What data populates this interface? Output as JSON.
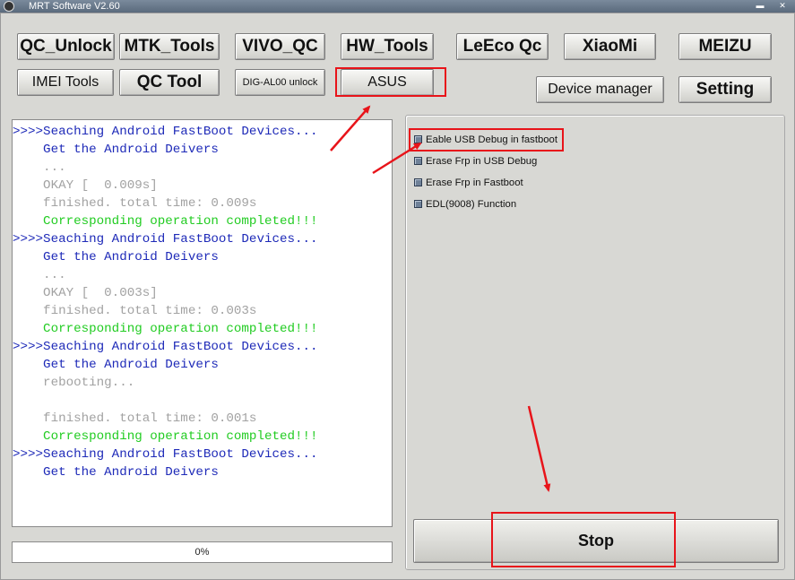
{
  "window": {
    "title": "MRT Software V2.60",
    "controls": {
      "minimize": "▬",
      "close": "✕"
    }
  },
  "toolbar": {
    "qc_unlock": "QC_Unlock",
    "mtk_tools": "MTK_Tools",
    "vivo_qc": "VIVO_QC",
    "hw_tools": "HW_Tools",
    "leeco_qc": "LeEco Qc",
    "xiaomi": "XiaoMi",
    "meizu": "MEIZU",
    "imei_tools": "IMEI Tools",
    "qc_tool": "QC Tool",
    "dig_al00_unlock": "DIG-AL00 unlock",
    "asus": "ASUS",
    "device_manager": "Device manager",
    "setting": "Setting"
  },
  "log": {
    "lines": [
      {
        "text": ">>>>Seaching Android FastBoot Devices...",
        "color": "#1e2ab8"
      },
      {
        "text": "    Get the Android Deivers",
        "color": "#1e2ab8"
      },
      {
        "text": "    ...",
        "color": "#a2a2a2"
      },
      {
        "text": "    OKAY [  0.009s]",
        "color": "#a2a2a2"
      },
      {
        "text": "    finished. total time: 0.009s",
        "color": "#a2a2a2"
      },
      {
        "text": "    Corresponding operation completed!!!",
        "color": "#22cc22"
      },
      {
        "text": ">>>>Seaching Android FastBoot Devices...",
        "color": "#1e2ab8"
      },
      {
        "text": "    Get the Android Deivers",
        "color": "#1e2ab8"
      },
      {
        "text": "    ...",
        "color": "#a2a2a2"
      },
      {
        "text": "    OKAY [  0.003s]",
        "color": "#a2a2a2"
      },
      {
        "text": "    finished. total time: 0.003s",
        "color": "#a2a2a2"
      },
      {
        "text": "    Corresponding operation completed!!!",
        "color": "#22cc22"
      },
      {
        "text": ">>>>Seaching Android FastBoot Devices...",
        "color": "#1e2ab8"
      },
      {
        "text": "    Get the Android Deivers",
        "color": "#1e2ab8"
      },
      {
        "text": "    rebooting...",
        "color": "#a2a2a2"
      },
      {
        "text": "",
        "color": "#a2a2a2"
      },
      {
        "text": "    finished. total time: 0.001s",
        "color": "#a2a2a2"
      },
      {
        "text": "    Corresponding operation completed!!!",
        "color": "#22cc22"
      },
      {
        "text": ">>>>Seaching Android FastBoot Devices...",
        "color": "#1e2ab8"
      },
      {
        "text": "    Get the Android Deivers",
        "color": "#1e2ab8"
      }
    ]
  },
  "progress": {
    "value": 0,
    "text": "0%"
  },
  "options": {
    "items": [
      {
        "label": "Eable USB Debug in fastboot"
      },
      {
        "label": "Erase Frp in USB Debug"
      },
      {
        "label": "Erase Frp in Fastboot"
      },
      {
        "label": "EDL(9008) Function"
      }
    ]
  },
  "actions": {
    "stop": "Stop"
  },
  "colors": {
    "highlight": "#e8141a",
    "log_blue": "#1e2ab8",
    "log_gray": "#a2a2a2",
    "log_green": "#22cc22"
  }
}
